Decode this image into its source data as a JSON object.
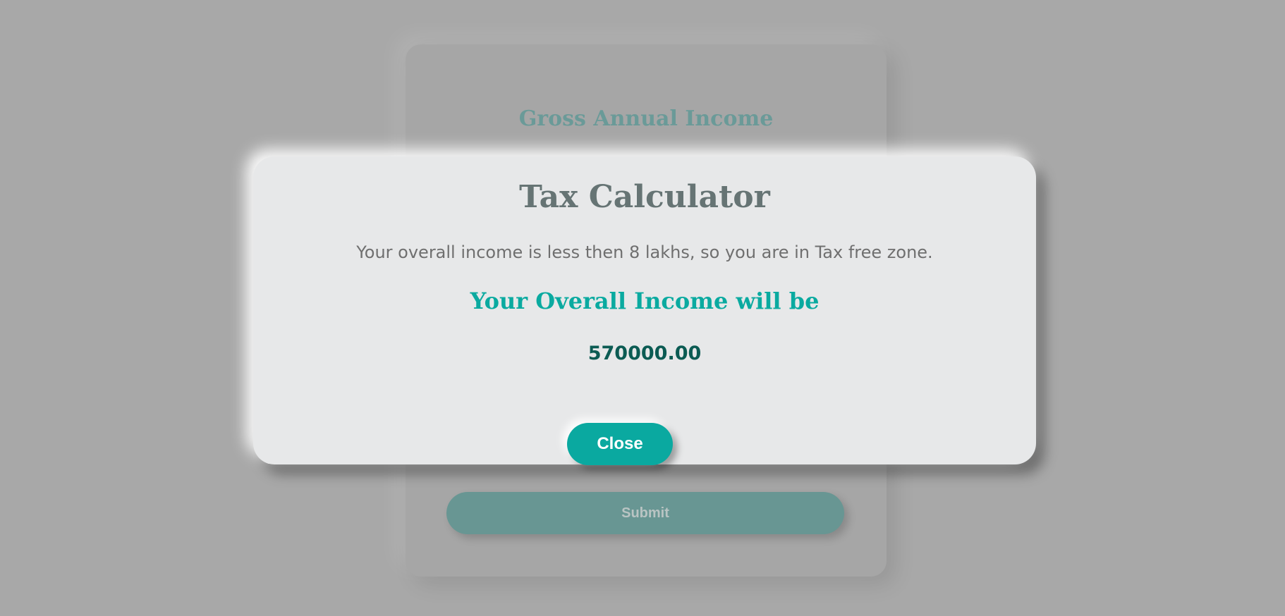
{
  "form": {
    "field_label": "Gross Annual Income",
    "submit_label": "Submit"
  },
  "modal": {
    "title": "Tax Calculator",
    "message": "Your overall income is less then 8 lakhs, so you are in Tax free zone.",
    "subtitle": "Your Overall Income will be",
    "amount": "570000.00",
    "close_label": "Close"
  },
  "colors": {
    "accent": "#0aa9a0",
    "amount": "#0b5b53",
    "overlay": "#a8a8a8",
    "modal_bg": "#e7e8e9"
  }
}
